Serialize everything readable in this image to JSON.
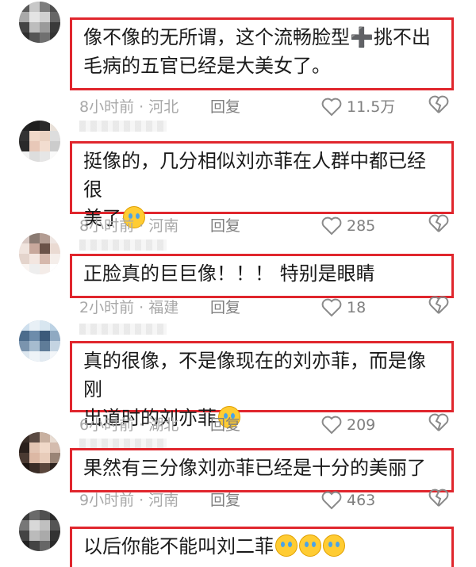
{
  "comments": [
    {
      "text": "像不像的无所谓，这个流畅脸型➕挑不出毛病的五官已经是大美女了。",
      "text_parts": [
        "像不像的无所谓，这个流畅脸型",
        "➕",
        "挑不出",
        "毛病的五官已经是大美女了。"
      ],
      "meta": "8小时前 · 河北",
      "reply": "回复",
      "likes": "11.5万"
    },
    {
      "text": "挺像的，几分相似刘亦菲在人群中都已经很美了",
      "text_parts": [
        "挺像的，几分相似刘亦菲在人群中都已经很",
        "美了"
      ],
      "emoji": "pleading-face-icon",
      "meta": "8小时前 · 河南",
      "reply": "回复",
      "likes": "285"
    },
    {
      "text": "正脸真的巨巨像！！！ 特别是眼睛",
      "meta": "2小时前 · 福建",
      "reply": "回复",
      "likes": "18"
    },
    {
      "text": "真的很像，不是像现在的刘亦菲，而是像刚出道时的刘亦菲",
      "text_parts": [
        "真的很像，不是像现在的刘亦菲，而是像刚",
        "出道时的刘亦菲"
      ],
      "emoji": "laughing-tears-icon",
      "meta": "6小时前 · 湖北",
      "reply": "回复",
      "likes": "209"
    },
    {
      "text": "果然有三分像刘亦菲已经是十分的美丽了",
      "meta": "9小时前 · 河南",
      "reply": "回复",
      "likes": "463"
    },
    {
      "text": "以后你能不能叫刘二菲",
      "emoji": "crying-face-icon",
      "meta": "",
      "reply": "",
      "likes": ""
    }
  ],
  "colors": {
    "highlight_border": "#e0262d",
    "meta_text": "#a8a8a8"
  }
}
